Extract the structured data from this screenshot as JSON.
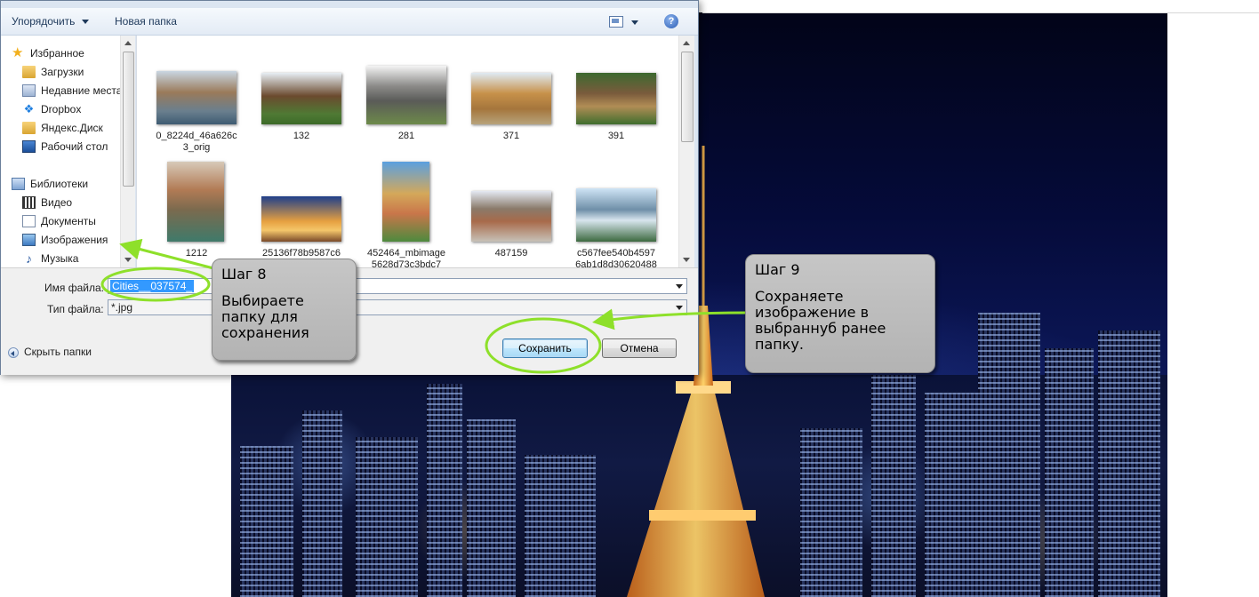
{
  "dialog": {
    "toolbar": {
      "organize": "Упорядочить",
      "new_folder": "Новая папка",
      "help": "?"
    },
    "nav": {
      "favorites_header": "Избранное",
      "favorites": [
        "Загрузки",
        "Недавние места",
        "Dropbox",
        "Яндекс.Диск",
        "Рабочий стол"
      ],
      "libraries_header": "Библиотеки",
      "libraries": [
        "Видео",
        "Документы",
        "Изображения",
        "Музыка"
      ]
    },
    "files": [
      {
        "name": "0_8224d_46a626c3_orig",
        "line1": "0_8224d_46a626c",
        "line2": "3_orig"
      },
      {
        "name": "132",
        "line1": "132",
        "line2": ""
      },
      {
        "name": "281",
        "line1": "281",
        "line2": ""
      },
      {
        "name": "371",
        "line1": "371",
        "line2": ""
      },
      {
        "name": "391",
        "line1": "391",
        "line2": ""
      },
      {
        "name": "1212",
        "line1": "1212",
        "line2": ""
      },
      {
        "name": "25136f78b9587c6",
        "line1": "25136f78b9587c6",
        "line2": ""
      },
      {
        "name": "452464_mbimage5628d73c3bdc7",
        "line1": "452464_mbimage",
        "line2": "5628d73c3bdc7"
      },
      {
        "name": "487159",
        "line1": "487159",
        "line2": ""
      },
      {
        "name": "c567fee540b45976ab1d8d30620488",
        "line1": "c567fee540b4597",
        "line2": "6ab1d8d30620488"
      }
    ],
    "form": {
      "filename_label": "Имя файла:",
      "filename_value": "Cities__037574_",
      "filetype_label": "Тип файла:",
      "filetype_value": "*.jpg",
      "hide_folders": "Скрыть папки",
      "save": "Сохранить",
      "cancel": "Отмена"
    }
  },
  "callouts": {
    "step8": {
      "title": "Шаг 8",
      "body": "Выбираете\nпапку для\nсохранения"
    },
    "step9": {
      "title": "Шаг 9",
      "body": "Сохраняете\nизображение в\nвыбраннуб ранее\nпапку."
    }
  },
  "colors": {
    "highlight_ring": "#8ee02a",
    "callout_bg": "#bdbdbd",
    "selection": "#3399ff"
  }
}
